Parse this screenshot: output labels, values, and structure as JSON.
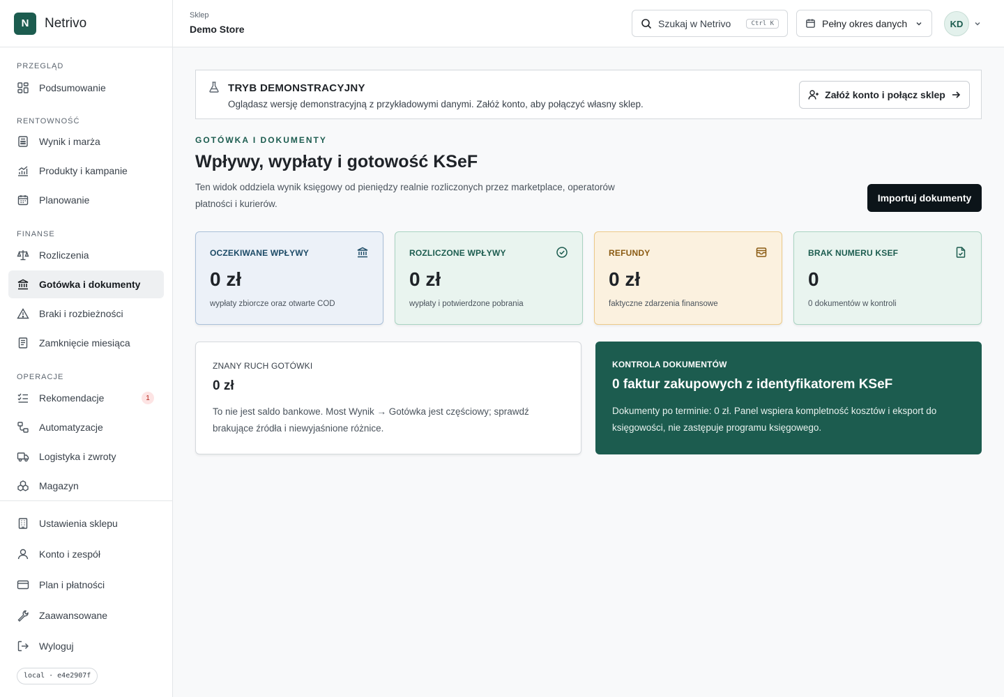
{
  "brand": {
    "logo_letter": "N",
    "name": "Netrivo"
  },
  "sidebar": {
    "sections": [
      {
        "label": "PRZEGLĄD",
        "items": [
          {
            "label": "Podsumowanie",
            "icon": "dashboard-icon"
          }
        ]
      },
      {
        "label": "RENTOWNOŚĆ",
        "items": [
          {
            "label": "Wynik i marża",
            "icon": "calculator-icon"
          },
          {
            "label": "Produkty i kampanie",
            "icon": "chart-icon"
          },
          {
            "label": "Planowanie",
            "icon": "calendar-icon"
          }
        ]
      },
      {
        "label": "FINANSE",
        "items": [
          {
            "label": "Rozliczenia",
            "icon": "scale-icon"
          },
          {
            "label": "Gotówka i dokumenty",
            "icon": "bank-icon",
            "active": true
          },
          {
            "label": "Braki i rozbieżności",
            "icon": "warning-icon"
          },
          {
            "label": "Zamknięcie miesiąca",
            "icon": "clipboard-icon"
          }
        ]
      },
      {
        "label": "OPERACJE",
        "items": [
          {
            "label": "Rekomendacje",
            "icon": "list-check-icon",
            "badge": "1"
          },
          {
            "label": "Automatyzacje",
            "icon": "workflow-icon"
          },
          {
            "label": "Logistyka i zwroty",
            "icon": "truck-icon"
          },
          {
            "label": "Magazyn",
            "icon": "boxes-icon"
          }
        ]
      }
    ],
    "bottom": [
      {
        "label": "Ustawienia sklepu",
        "icon": "building-icon"
      },
      {
        "label": "Konto i zespół",
        "icon": "user-icon"
      },
      {
        "label": "Plan i płatności",
        "icon": "credit-card-icon"
      },
      {
        "label": "Zaawansowane",
        "icon": "wrench-icon"
      },
      {
        "label": "Wyloguj",
        "icon": "logout-icon"
      }
    ],
    "version": "local · e4e2907f"
  },
  "topbar": {
    "store_label": "Sklep",
    "store_name": "Demo Store",
    "search_placeholder": "Szukaj w Netrivo",
    "search_shortcut": "Ctrl K",
    "period": "Pełny okres danych",
    "avatar_initials": "KD"
  },
  "demo": {
    "title": "TRYB DEMONSTRACYJNY",
    "text": "Oglądasz wersję demonstracyjną z przykładowymi danymi. Załóż konto, aby połączyć własny sklep.",
    "button": "Załóż konto i połącz sklep"
  },
  "page": {
    "eyebrow": "GOTÓWKA I DOKUMENTY",
    "title": "Wpływy, wypłaty i gotowość KSeF",
    "description": "Ten widok oddziela wynik księgowy od pieniędzy realnie rozliczonych przez marketplace, operatorów płatności i kurierów.",
    "import_button": "Importuj dokumenty"
  },
  "kpis": [
    {
      "label": "OCZEKIWANE WPŁYWY",
      "value": "0 zł",
      "sub": "wypłaty zbiorcze oraz otwarte COD",
      "icon": "bank-icon",
      "bg": "#ecf1f8",
      "border": "#a9bfd8",
      "accent": "#1c4a66"
    },
    {
      "label": "ROZLICZONE WPŁYWY",
      "value": "0 zł",
      "sub": "wypłaty i potwierdzone pobrania",
      "icon": "check-circle-icon",
      "bg": "#e9f4ef",
      "border": "#a9d3c2",
      "accent": "#1c5c4f"
    },
    {
      "label": "REFUNDY",
      "value": "0 zł",
      "sub": "faktyczne zdarzenia finansowe",
      "icon": "wallet-icon",
      "bg": "#fbf1df",
      "border": "#ecc988",
      "accent": "#8a5a12"
    },
    {
      "label": "BRAK NUMERU KSEF",
      "value": "0",
      "sub": "0 dokumentów w kontroli",
      "icon": "file-check-icon",
      "bg": "#e9f4ef",
      "border": "#a9d3c2",
      "accent": "#1c5c4f"
    }
  ],
  "cash": {
    "label": "ZNANY RUCH GOTÓWKI",
    "value": "0 zł",
    "text": "To nie jest saldo bankowe. Most Wynik → Gotówka jest częściowy; sprawdź brakujące źródła i niewyjaśnione różnice."
  },
  "doc_control": {
    "label": "KONTROLA DOKUMENTÓW",
    "title": "0 faktur zakupowych z identyfikatorem KSeF",
    "text": "Dokumenty po terminie: 0 zł. Panel wspiera kompletność kosztów i eksport do księgowości, nie zastępuje programu księgowego."
  }
}
